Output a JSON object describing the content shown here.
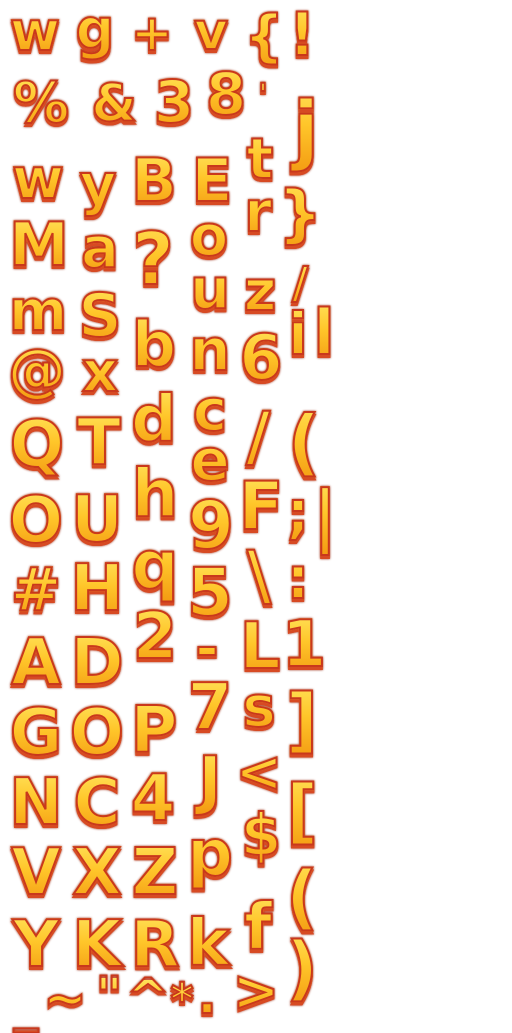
{
  "glyphs": [
    "w",
    "g",
    "+",
    "v",
    "{",
    "!",
    "%",
    "&",
    "3",
    "8",
    "'",
    "j",
    "w",
    "y",
    "B",
    "E",
    "t",
    "r",
    "}",
    "M",
    "a",
    "?",
    "o",
    "m",
    "S",
    "u",
    "z",
    "/",
    "@",
    "x",
    "b",
    "n",
    "6",
    "i",
    "l",
    "Q",
    "T",
    "d",
    "c",
    "e",
    "/",
    "(",
    "O",
    "U",
    "h",
    "9",
    "F",
    ";",
    "|",
    "#",
    "H",
    "q",
    "5",
    "\\",
    ":",
    "A",
    "D",
    "2",
    "-",
    "L",
    "1",
    "G",
    "O",
    "P",
    "7",
    "s",
    "]",
    "N",
    "C",
    "4",
    "J",
    "<",
    "[",
    "V",
    "X",
    "Z",
    "p",
    "$",
    "Y",
    "K",
    "R",
    "k",
    "f",
    "(",
    ")",
    "_",
    "~",
    "\"",
    "^",
    "*",
    ".",
    ">"
  ],
  "colors": {
    "fill_top": "#ffe25a",
    "fill_mid": "#ffc62a",
    "fill_bottom": "#f39a12",
    "outline": "#c9381c",
    "shadow": "#d74a23",
    "background": "#ffffff"
  }
}
